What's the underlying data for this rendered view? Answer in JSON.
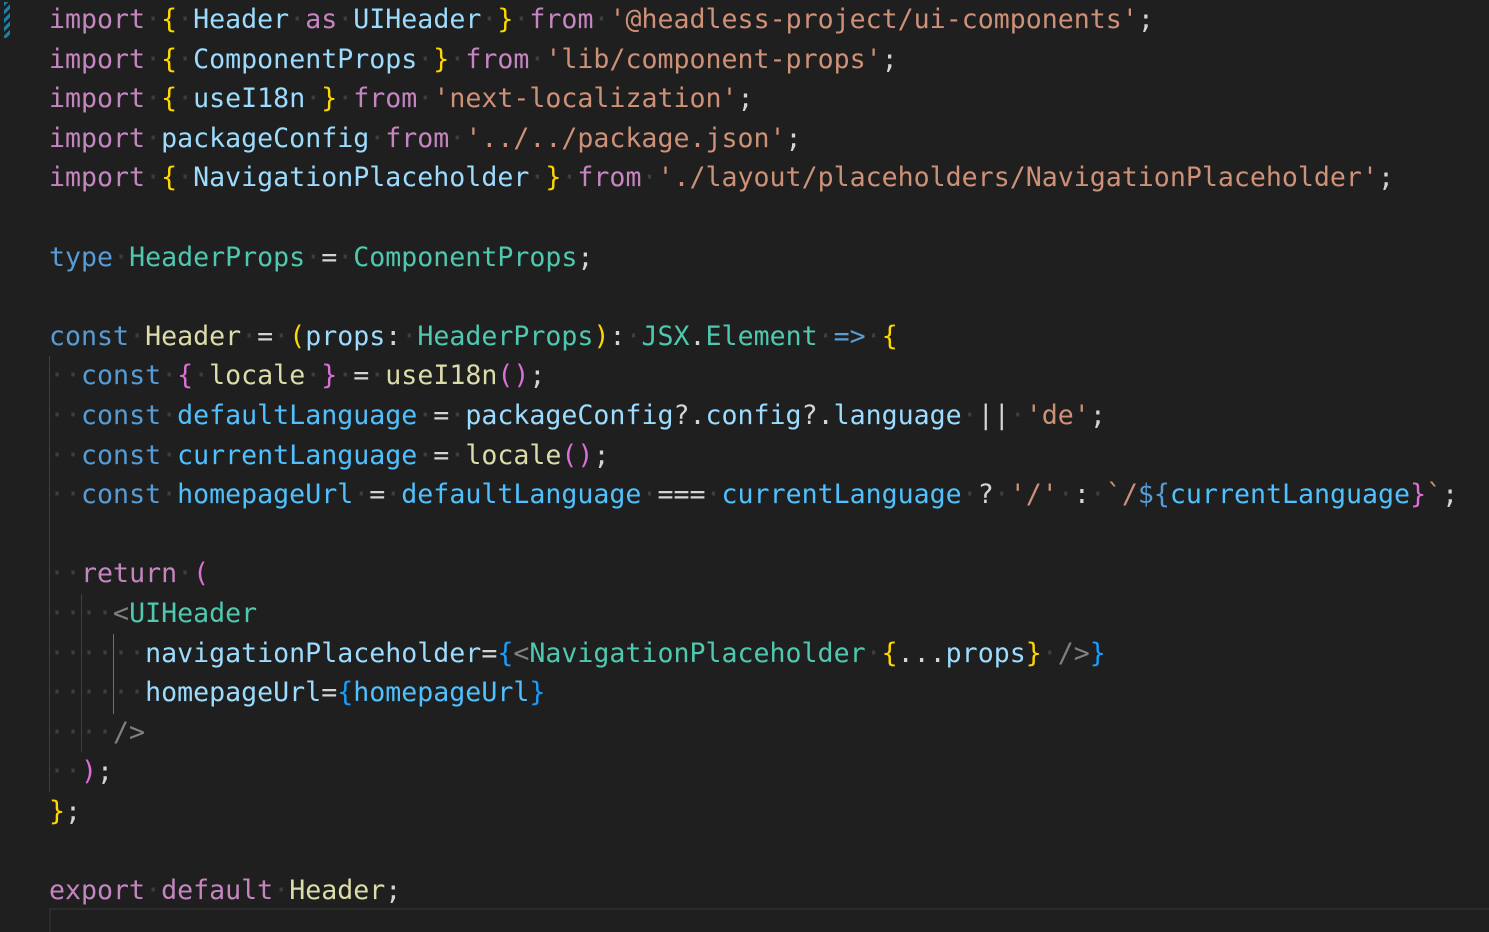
{
  "editor": {
    "language": "typescriptreact",
    "theme_colors": {
      "background": "#1f1f1f",
      "keyword_control": "#c586c0",
      "keyword_storage": "#569cd6",
      "variable": "#9cdcfe",
      "constant_variable": "#4fc1ff",
      "type": "#4ec9b0",
      "function": "#dcdcaa",
      "string": "#ce9178",
      "bracket_level_1": "#ffd700",
      "bracket_level_2": "#da70d6",
      "bracket_level_3": "#179fff",
      "jsx_tag_punct": "#808080",
      "whitespace_dot": "#3e3e3e",
      "gutter_modified": "#1b81a8"
    },
    "lines": [
      [
        [
          "k-import",
          "import"
        ],
        [
          "ws",
          "·"
        ],
        [
          "br1",
          "{"
        ],
        [
          "ws",
          "·"
        ],
        [
          "var",
          "Header"
        ],
        [
          "ws",
          "·"
        ],
        [
          "k-import",
          "as"
        ],
        [
          "ws",
          "·"
        ],
        [
          "var",
          "UIHeader"
        ],
        [
          "ws",
          "·"
        ],
        [
          "br1",
          "}"
        ],
        [
          "ws",
          "·"
        ],
        [
          "k-import",
          "from"
        ],
        [
          "ws",
          "·"
        ],
        [
          "str",
          "'@headless-project/ui-components'"
        ],
        [
          "punct",
          ";"
        ]
      ],
      [
        [
          "k-import",
          "import"
        ],
        [
          "ws",
          "·"
        ],
        [
          "br1",
          "{"
        ],
        [
          "ws",
          "·"
        ],
        [
          "var",
          "ComponentProps"
        ],
        [
          "ws",
          "·"
        ],
        [
          "br1",
          "}"
        ],
        [
          "ws",
          "·"
        ],
        [
          "k-import",
          "from"
        ],
        [
          "ws",
          "·"
        ],
        [
          "str",
          "'lib/component-props'"
        ],
        [
          "punct",
          ";"
        ]
      ],
      [
        [
          "k-import",
          "import"
        ],
        [
          "ws",
          "·"
        ],
        [
          "br1",
          "{"
        ],
        [
          "ws",
          "·"
        ],
        [
          "var",
          "useI18n"
        ],
        [
          "ws",
          "·"
        ],
        [
          "br1",
          "}"
        ],
        [
          "ws",
          "·"
        ],
        [
          "k-import",
          "from"
        ],
        [
          "ws",
          "·"
        ],
        [
          "str",
          "'next-localization'"
        ],
        [
          "punct",
          ";"
        ]
      ],
      [
        [
          "k-import",
          "import"
        ],
        [
          "ws",
          "·"
        ],
        [
          "var",
          "packageConfig"
        ],
        [
          "ws",
          "·"
        ],
        [
          "k-import",
          "from"
        ],
        [
          "ws",
          "·"
        ],
        [
          "str",
          "'../../package.json'"
        ],
        [
          "punct",
          ";"
        ]
      ],
      [
        [
          "k-import",
          "import"
        ],
        [
          "ws",
          "·"
        ],
        [
          "br1",
          "{"
        ],
        [
          "ws",
          "·"
        ],
        [
          "var",
          "NavigationPlaceholder"
        ],
        [
          "ws",
          "·"
        ],
        [
          "br1",
          "}"
        ],
        [
          "ws",
          "·"
        ],
        [
          "k-import",
          "from"
        ],
        [
          "ws",
          "·"
        ],
        [
          "str",
          "'./layout/placeholders/NavigationPlaceholder'"
        ],
        [
          "punct",
          ";"
        ]
      ],
      [],
      [
        [
          "k-blue",
          "type"
        ],
        [
          "ws",
          "·"
        ],
        [
          "type",
          "HeaderProps"
        ],
        [
          "ws",
          "·"
        ],
        [
          "punct",
          "="
        ],
        [
          "ws",
          "·"
        ],
        [
          "type",
          "ComponentProps"
        ],
        [
          "punct",
          ";"
        ]
      ],
      [],
      [
        [
          "k-blue",
          "const"
        ],
        [
          "ws",
          "·"
        ],
        [
          "fn",
          "Header"
        ],
        [
          "ws",
          "·"
        ],
        [
          "punct",
          "="
        ],
        [
          "ws",
          "·"
        ],
        [
          "br1",
          "("
        ],
        [
          "var",
          "props"
        ],
        [
          "punct",
          ":"
        ],
        [
          "ws",
          "·"
        ],
        [
          "type",
          "HeaderProps"
        ],
        [
          "br1",
          ")"
        ],
        [
          "punct",
          ":"
        ],
        [
          "ws",
          "·"
        ],
        [
          "type",
          "JSX"
        ],
        [
          "punct",
          "."
        ],
        [
          "type",
          "Element"
        ],
        [
          "ws",
          "·"
        ],
        [
          "k-blue",
          "=>"
        ],
        [
          "ws",
          "·"
        ],
        [
          "br1",
          "{"
        ]
      ],
      [
        [
          "ws",
          "··"
        ],
        [
          "k-blue",
          "const"
        ],
        [
          "ws",
          "·"
        ],
        [
          "br2",
          "{"
        ],
        [
          "ws",
          "·"
        ],
        [
          "fn",
          "locale"
        ],
        [
          "ws",
          "·"
        ],
        [
          "br2",
          "}"
        ],
        [
          "ws",
          "·"
        ],
        [
          "punct",
          "="
        ],
        [
          "ws",
          "·"
        ],
        [
          "fn",
          "useI18n"
        ],
        [
          "br2",
          "()"
        ],
        [
          "punct",
          ";"
        ]
      ],
      [
        [
          "ws",
          "··"
        ],
        [
          "k-blue",
          "const"
        ],
        [
          "ws",
          "·"
        ],
        [
          "const-var",
          "defaultLanguage"
        ],
        [
          "ws",
          "·"
        ],
        [
          "punct",
          "="
        ],
        [
          "ws",
          "·"
        ],
        [
          "var",
          "packageConfig"
        ],
        [
          "punct",
          "?."
        ],
        [
          "var",
          "config"
        ],
        [
          "punct",
          "?."
        ],
        [
          "var",
          "language"
        ],
        [
          "ws",
          "·"
        ],
        [
          "punct",
          "||"
        ],
        [
          "ws",
          "·"
        ],
        [
          "str",
          "'de'"
        ],
        [
          "punct",
          ";"
        ]
      ],
      [
        [
          "ws",
          "··"
        ],
        [
          "k-blue",
          "const"
        ],
        [
          "ws",
          "·"
        ],
        [
          "const-var",
          "currentLanguage"
        ],
        [
          "ws",
          "·"
        ],
        [
          "punct",
          "="
        ],
        [
          "ws",
          "·"
        ],
        [
          "fn",
          "locale"
        ],
        [
          "br2",
          "()"
        ],
        [
          "punct",
          ";"
        ]
      ],
      [
        [
          "ws",
          "··"
        ],
        [
          "k-blue",
          "const"
        ],
        [
          "ws",
          "·"
        ],
        [
          "const-var",
          "homepageUrl"
        ],
        [
          "ws",
          "·"
        ],
        [
          "punct",
          "="
        ],
        [
          "ws",
          "·"
        ],
        [
          "const-var",
          "defaultLanguage"
        ],
        [
          "ws",
          "·"
        ],
        [
          "punct",
          "==="
        ],
        [
          "ws",
          "·"
        ],
        [
          "const-var",
          "currentLanguage"
        ],
        [
          "ws",
          "·"
        ],
        [
          "punct",
          "?"
        ],
        [
          "ws",
          "·"
        ],
        [
          "str",
          "'/'"
        ],
        [
          "ws",
          "·"
        ],
        [
          "punct",
          ":"
        ],
        [
          "ws",
          "·"
        ],
        [
          "str",
          "`/"
        ],
        [
          "k-blue",
          "${"
        ],
        [
          "br2",
          ""
        ],
        [
          "const-var",
          "currentLanguage"
        ],
        [
          "k-blue",
          ""
        ],
        [
          "br2",
          "}"
        ],
        [
          "str",
          "`"
        ],
        [
          "punct",
          ";"
        ]
      ],
      [],
      [
        [
          "ws",
          "··"
        ],
        [
          "k-import",
          "return"
        ],
        [
          "ws",
          "·"
        ],
        [
          "br2",
          "("
        ]
      ],
      [
        [
          "ws",
          "····"
        ],
        [
          "tag",
          "<"
        ],
        [
          "type",
          "UIHeader"
        ]
      ],
      [
        [
          "ws",
          "······"
        ],
        [
          "var",
          "navigationPlaceholder"
        ],
        [
          "punct",
          "="
        ],
        [
          "br3",
          "{"
        ],
        [
          "tag",
          "<"
        ],
        [
          "type",
          "NavigationPlaceholder"
        ],
        [
          "ws",
          "·"
        ],
        [
          "br1",
          "{"
        ],
        [
          "punct",
          "..."
        ],
        [
          "var",
          "props"
        ],
        [
          "br1",
          "}"
        ],
        [
          "ws",
          "·"
        ],
        [
          "tag",
          "/>"
        ],
        [
          "br3",
          "}"
        ]
      ],
      [
        [
          "ws",
          "······"
        ],
        [
          "var",
          "homepageUrl"
        ],
        [
          "punct",
          "="
        ],
        [
          "br3",
          "{"
        ],
        [
          "const-var",
          "homepageUrl"
        ],
        [
          "br3",
          "}"
        ]
      ],
      [
        [
          "ws",
          "····"
        ],
        [
          "tag",
          "/>"
        ]
      ],
      [
        [
          "ws",
          "··"
        ],
        [
          "br2",
          ")"
        ],
        [
          "punct",
          ";"
        ]
      ],
      [
        [
          "br1",
          "}"
        ],
        [
          "punct",
          ";"
        ]
      ],
      [],
      [
        [
          "k-import",
          "export"
        ],
        [
          "ws",
          "·"
        ],
        [
          "k-import",
          "default"
        ],
        [
          "ws",
          "·"
        ],
        [
          "fn",
          "Header"
        ],
        [
          "punct",
          ";"
        ]
      ]
    ]
  }
}
